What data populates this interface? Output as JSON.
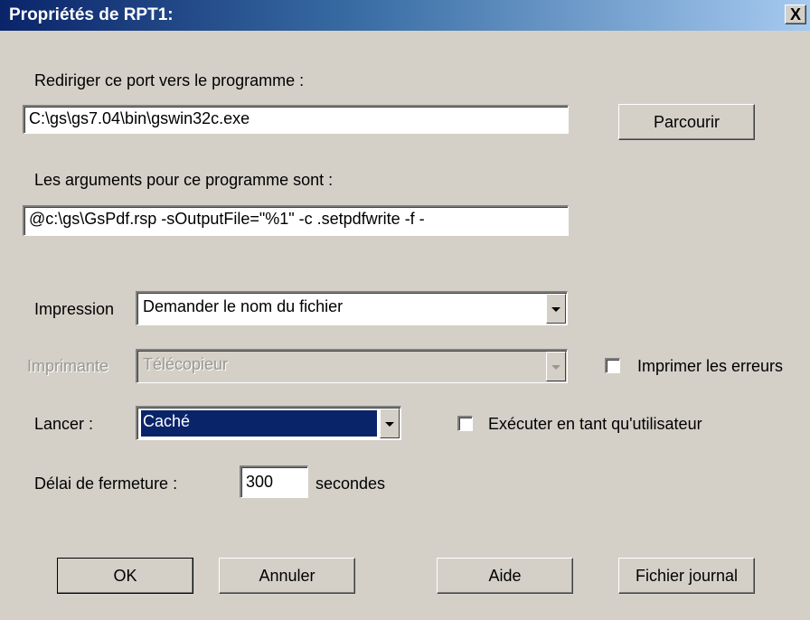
{
  "window": {
    "title": "Propriétés de RPT1:",
    "close_label": "X"
  },
  "redirect": {
    "label": "Rediriger ce port vers le programme :",
    "value": "C:\\gs\\gs7.04\\bin\\gswin32c.exe",
    "browse_label": "Parcourir"
  },
  "arguments": {
    "label": "Les arguments pour ce programme sont :",
    "value": "@c:\\gs\\GsPdf.rsp -sOutputFile=\"%1\" -c .setpdfwrite -f -"
  },
  "impression": {
    "label": "Impression",
    "selected": "Demander le nom du fichier"
  },
  "imprimante": {
    "label": "Imprimante",
    "selected": "Télécopieur",
    "enabled": false
  },
  "print_errors": {
    "label": "Imprimer les erreurs",
    "checked": false
  },
  "lancer": {
    "label": "Lancer :",
    "selected": "Caché"
  },
  "run_as_user": {
    "label": "Exécuter en tant qu'utilisateur",
    "checked": false
  },
  "close_delay": {
    "label": "Délai de fermeture :",
    "value": "300",
    "unit": "secondes"
  },
  "buttons": {
    "ok": "OK",
    "cancel": "Annuler",
    "help": "Aide",
    "log": "Fichier journal"
  },
  "colors": {
    "face": "#d4d0c8",
    "title_start": "#0a246a",
    "title_end": "#a6caf0",
    "selection": "#0a246a"
  }
}
